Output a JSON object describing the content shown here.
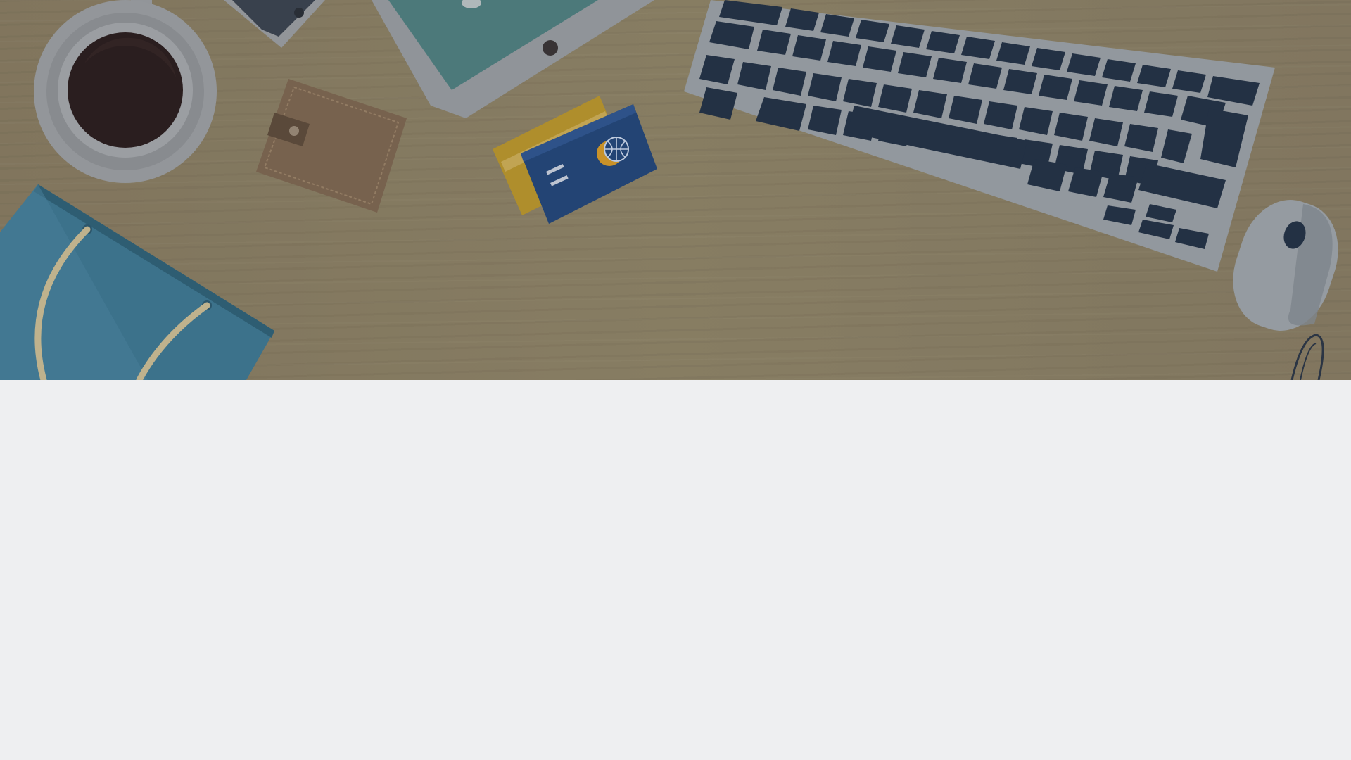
{
  "hero": {
    "illustration": "desk-workspace",
    "items": [
      "coffee-cup-icon",
      "smartphone-icon",
      "tablet-icon",
      "wallet-icon",
      "credit-cards-icon",
      "keyboard-icon",
      "mouse-icon",
      "shopping-bag-icon",
      "earphones-icon"
    ]
  },
  "colors": {
    "desk": "#8b7f64",
    "background": "#eeeff1",
    "keyboard_keys": "#243247",
    "keyboard_body": "#9aa0a6",
    "tablet_screen": "#4f7f80",
    "bag": "#3e7792",
    "card_blue": "#24477a",
    "card_gold": "#b8952d",
    "wallet": "#7d6651",
    "coffee": "#2a1d1d"
  }
}
